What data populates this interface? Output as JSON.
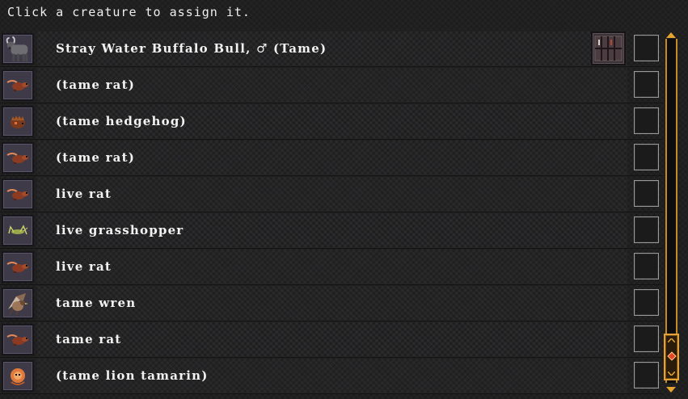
{
  "instruction": "Click a creature to assign it.",
  "creatures": [
    {
      "name": "Stray Water Buffalo Bull, ♂ (Tame)",
      "icon": "water-buffalo-icon",
      "has_cage": true
    },
    {
      "name": "(tame rat)",
      "icon": "rat-icon"
    },
    {
      "name": "(tame hedgehog)",
      "icon": "hedgehog-icon"
    },
    {
      "name": "(tame rat)",
      "icon": "rat-icon"
    },
    {
      "name": "live rat",
      "icon": "rat-icon"
    },
    {
      "name": "live grasshopper",
      "icon": "grasshopper-icon"
    },
    {
      "name": "live rat",
      "icon": "rat-icon"
    },
    {
      "name": "tame wren",
      "icon": "wren-icon"
    },
    {
      "name": "tame rat",
      "icon": "rat-icon"
    },
    {
      "name": "(tame lion tamarin)",
      "icon": "lion-tamarin-icon"
    }
  ],
  "cage_icon": "cage-icon",
  "colors": {
    "accent": "#e5a430",
    "text": "#f2f2f2",
    "portrait_bg": "#3e3a48"
  }
}
